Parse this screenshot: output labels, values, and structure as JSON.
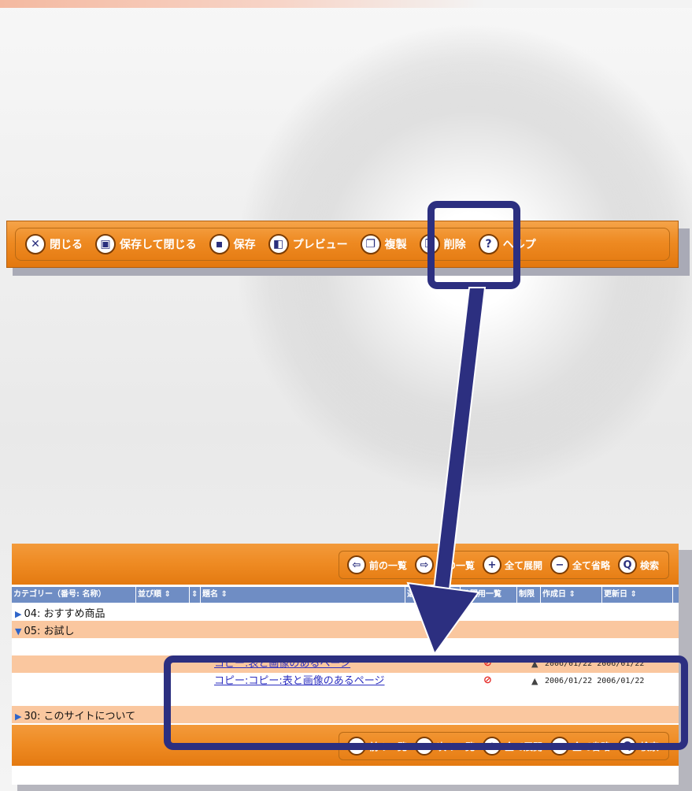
{
  "toolbar": {
    "buttons": [
      {
        "icon": "close-icon",
        "glyph": "✕",
        "label": "閉じる"
      },
      {
        "icon": "save-close-icon",
        "glyph": "▣",
        "label": "保存して閉じる"
      },
      {
        "icon": "save-icon",
        "glyph": "▪",
        "label": "保存"
      },
      {
        "icon": "preview-icon",
        "glyph": "◧",
        "label": "プレビュー"
      },
      {
        "icon": "copy-icon",
        "glyph": "❐",
        "label": "複製"
      },
      {
        "icon": "delete-icon",
        "glyph": "❒",
        "label": "削除"
      },
      {
        "icon": "help-icon",
        "glyph": "?",
        "label": "ヘルプ"
      }
    ]
  },
  "nav": {
    "prev_label": "前の一覧",
    "next_label": "次の一覧",
    "expand_label": "全て展開",
    "collapse_label": "全て省略",
    "search_label": "検索"
  },
  "table": {
    "headers": {
      "category": "カテゴリー（番号: 名称）",
      "order": "並び順 ⇕",
      "sort": "⇕",
      "title": "題名 ⇕",
      "column5": "選",
      "public_list": "公開用一覧",
      "restriction": "制限",
      "created": "作成日 ⇕",
      "updated": "更新日 ⇕"
    },
    "categories": [
      {
        "label": "04: おすすめ商品",
        "state": "collapsed"
      },
      {
        "label": "05: お試し",
        "state": "expanded"
      },
      {
        "label": "30: このサイトについて",
        "state": "collapsed"
      }
    ],
    "rows": [
      {
        "title": "コピー:表と画像のあるページ",
        "created": "2006/01/22",
        "updated": "2006/01/22"
      },
      {
        "title": "コピー:コピー:表と画像のあるページ",
        "created": "2006/01/22",
        "updated": "2006/01/22"
      }
    ]
  },
  "colors": {
    "accent_orange": "#ee8a22",
    "highlight_navy": "#2c2f80",
    "row_alt": "#fac79f",
    "header_blue": "#6f8dc4"
  }
}
